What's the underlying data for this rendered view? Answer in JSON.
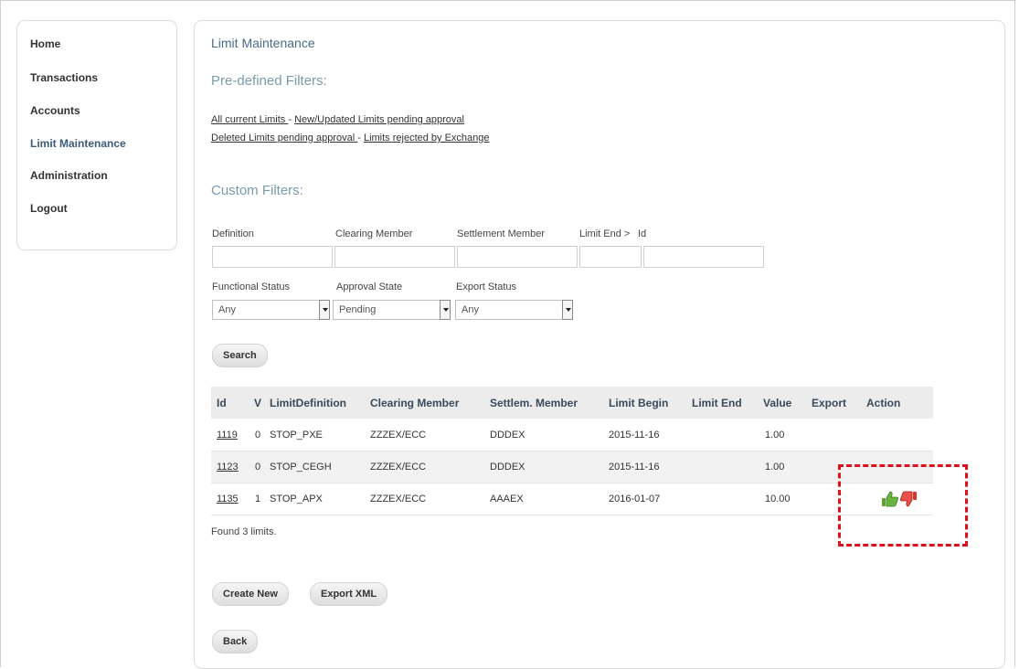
{
  "nav": {
    "items": [
      {
        "label": "Home"
      },
      {
        "label": "Transactions"
      },
      {
        "label": "Accounts"
      },
      {
        "label": "Limit Maintenance"
      },
      {
        "label": "Administration"
      },
      {
        "label": "Logout"
      }
    ]
  },
  "page": {
    "title": "Limit Maintenance",
    "predefined_title": "Pre-defined Filters:",
    "predef_links": {
      "all_current": "All current Limits ",
      "sep1": " - ",
      "new_updated": "New/Updated Limits pending approval",
      "deleted": "Deleted Limits pending approval ",
      "sep2": " - ",
      "rejected": "Limits rejected by Exchange"
    },
    "custom_title": "Custom Filters:"
  },
  "filters": {
    "definition_label": "Definition",
    "clearing_member_label": "Clearing Member",
    "settlement_member_label": "Settlement Member",
    "limit_end_label": "Limit End >",
    "id_label": "Id",
    "functional_status_label": "Functional Status",
    "functional_status_value": "Any",
    "approval_state_label": "Approval State",
    "approval_state_value": "Pending",
    "export_status_label": "Export Status",
    "export_status_value": "Any",
    "search_label": "Search"
  },
  "table": {
    "headers": [
      "Id",
      "V",
      "LimitDefinition",
      "Clearing Member",
      "Settlem. Member",
      "Limit Begin",
      "Limit End",
      "Value",
      "Export",
      "Action"
    ],
    "rows": [
      {
        "id": "1119",
        "v": "0",
        "definition": "STOP_PXE",
        "clearing": "ZZZEX/ECC",
        "settlement": "DDDEX",
        "begin": "2015-11-16",
        "end": "",
        "value": "1.00",
        "export": ""
      },
      {
        "id": "1123",
        "v": "0",
        "definition": "STOP_CEGH",
        "clearing": "ZZZEX/ECC",
        "settlement": "DDDEX",
        "begin": "2015-11-16",
        "end": "",
        "value": "1.00",
        "export": ""
      },
      {
        "id": "1135",
        "v": "1",
        "definition": "STOP_APX",
        "clearing": "ZZZEX/ECC",
        "settlement": "AAAEX",
        "begin": "2016-01-07",
        "end": "",
        "value": "10.00",
        "export": ""
      }
    ],
    "found_text": "Found 3 limits."
  },
  "actions": {
    "create_new": "Create New",
    "export_xml": "Export XML",
    "back": "Back"
  },
  "icons": {
    "approve": "thumbs-up-icon",
    "reject": "thumbs-down-icon"
  },
  "colors": {
    "approve": "#5aa02c",
    "reject": "#d9352b",
    "highlight": "#e0101a"
  }
}
